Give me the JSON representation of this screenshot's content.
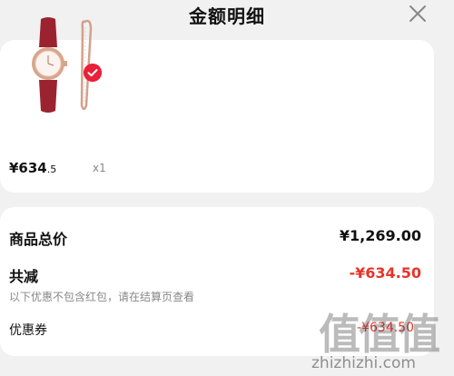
{
  "header": {
    "title": "金额明细",
    "close_icon": "close-icon"
  },
  "goods": {
    "image_icon": "watch-with-bracelet-image",
    "selected_icon": "check-circle-icon",
    "price_main": "¥634",
    "price_decimal": ".5",
    "quantity": "x1"
  },
  "summary": {
    "total_label": "商品总价",
    "total_value": "¥1,269.00",
    "reduction_label": "共减",
    "reduction_value": "-¥634.50",
    "note": "以下优惠不包含红包，请在结算页查看",
    "coupon_label": "优惠券",
    "coupon_value": "-¥634.50"
  },
  "watermark": {
    "logo": "值值值",
    "url": "zhizhizhi.com"
  },
  "colors": {
    "accent_red": "#e6342a",
    "badge_red": "#ea1f3a",
    "background": "#f1f1f1"
  }
}
